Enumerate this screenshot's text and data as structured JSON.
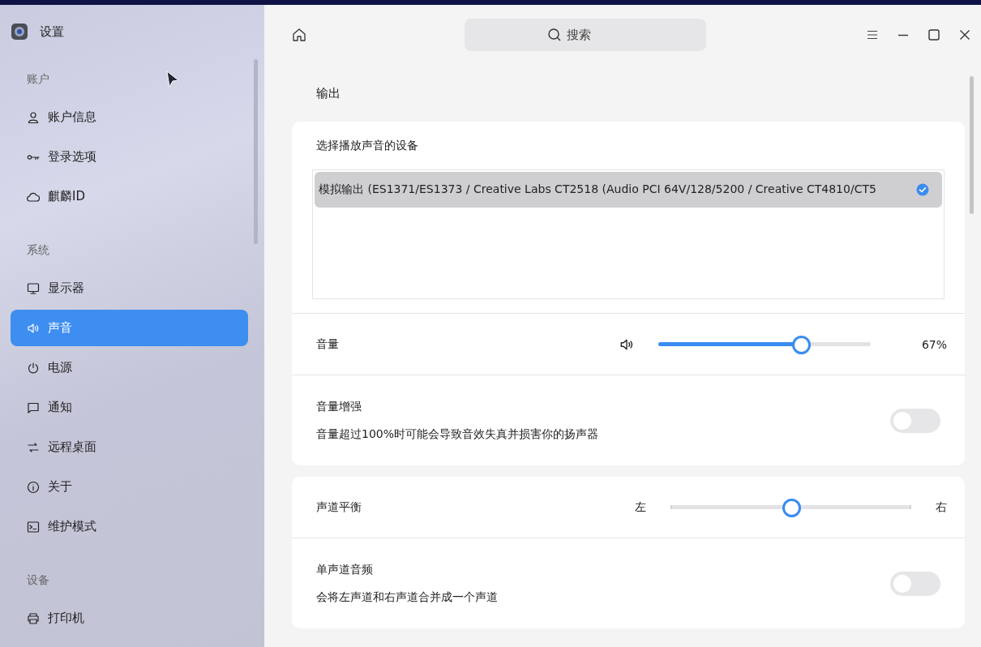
{
  "window": {
    "title": "设置"
  },
  "search": {
    "placeholder": "搜索"
  },
  "sidebar": {
    "groups": [
      {
        "label": "账户",
        "items": [
          {
            "label": "账户信息",
            "selected": false
          },
          {
            "label": "登录选项",
            "selected": false
          },
          {
            "label": "麒麟ID",
            "selected": false
          }
        ]
      },
      {
        "label": "系统",
        "items": [
          {
            "label": "显示器",
            "selected": false
          },
          {
            "label": "声音",
            "selected": true
          },
          {
            "label": "电源",
            "selected": false
          },
          {
            "label": "通知",
            "selected": false
          },
          {
            "label": "远程桌面",
            "selected": false
          },
          {
            "label": "关于",
            "selected": false
          },
          {
            "label": "维护模式",
            "selected": false
          }
        ]
      },
      {
        "label": "设备",
        "items": [
          {
            "label": "打印机",
            "selected": false
          }
        ]
      }
    ]
  },
  "output": {
    "section_title": "输出",
    "device_prompt": "选择播放声音的设备",
    "devices": [
      {
        "label": "模拟输出 (ES1371/ES1373 / Creative Labs CT2518 (Audio PCI 64V/128/5200 / Creative CT4810/CT5",
        "selected": true
      }
    ]
  },
  "cards": [
    {
      "rows": [
        {
          "kind": "volume",
          "label": "音量",
          "level": 0.67,
          "reading": "67%"
        },
        {
          "kind": "toggle",
          "label": "音量增强",
          "description": "音量超过100%时可能会导致音效失真并损害你的扬声器",
          "on": false
        }
      ]
    },
    {
      "rows": [
        {
          "kind": "balance",
          "label": "声道平衡",
          "left_label": "左",
          "right_label": "右",
          "level": 0.5
        },
        {
          "kind": "toggle",
          "label": "单声道音频",
          "description": "会将左声道和右声道合并成一个声道",
          "on": false
        }
      ]
    }
  ]
}
